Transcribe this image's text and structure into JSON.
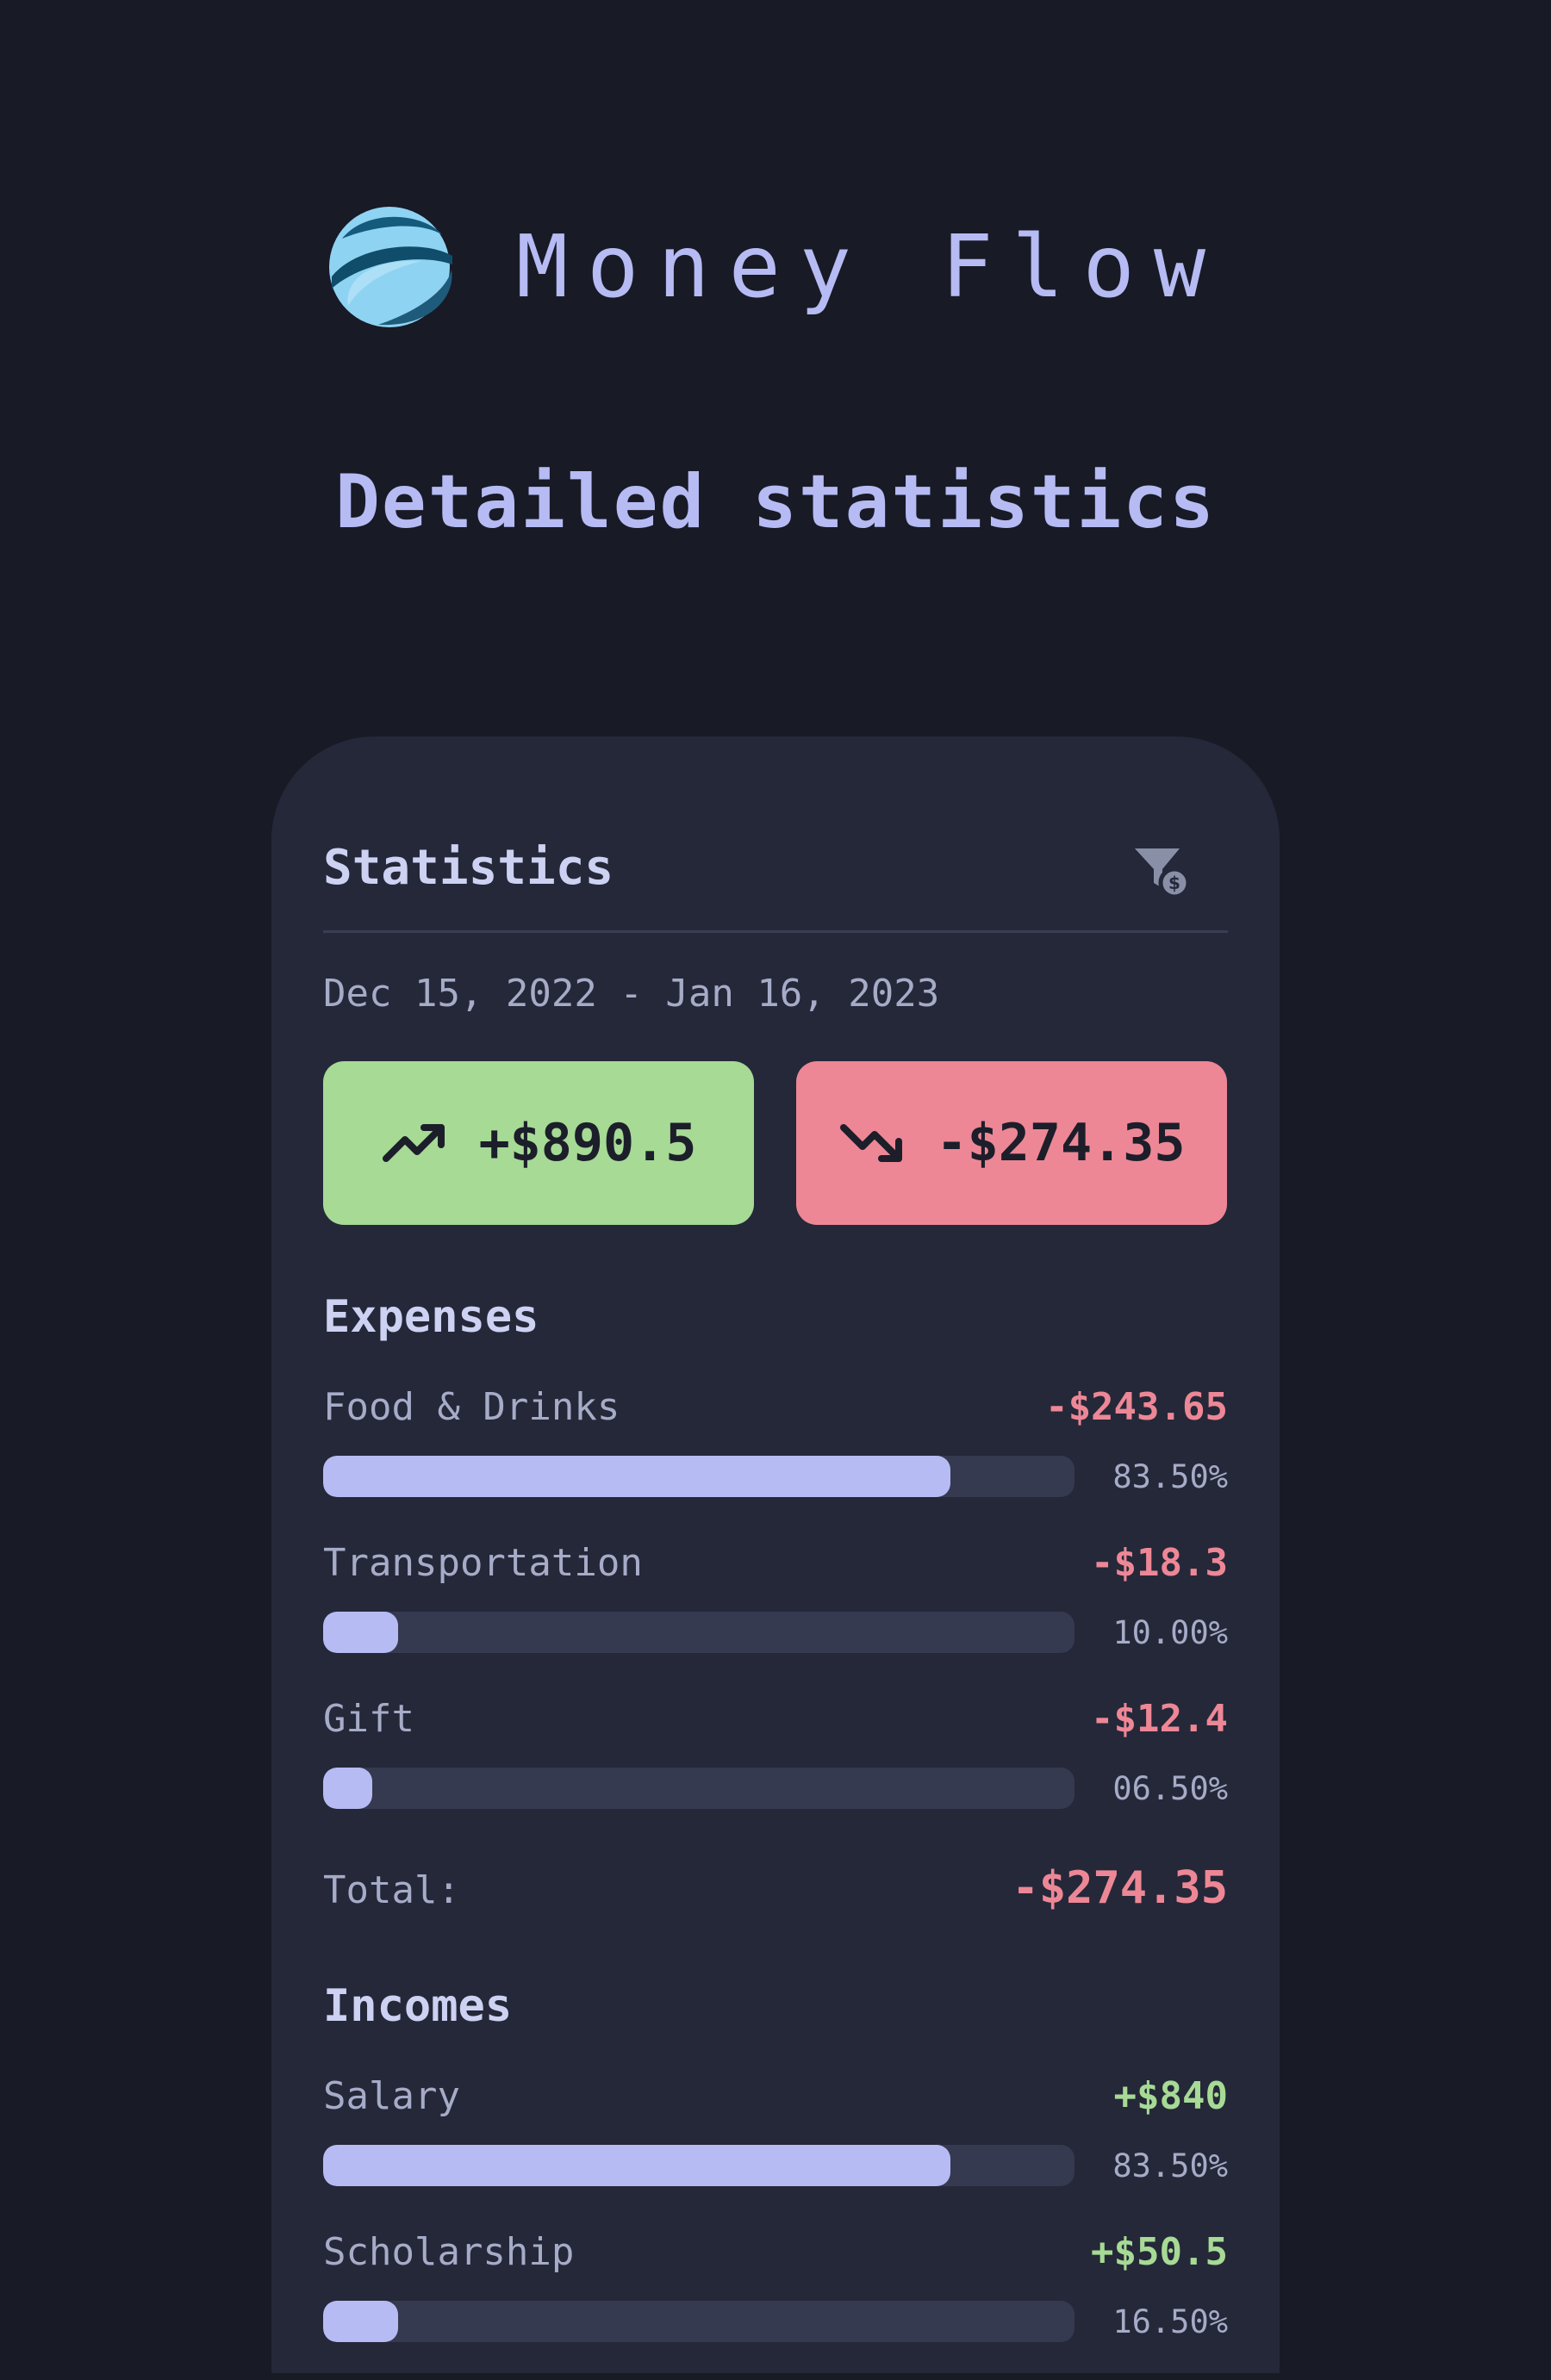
{
  "app": {
    "name": "Money Flow",
    "logo": "globe-swirl-logo"
  },
  "page": {
    "title": "Detailed statistics"
  },
  "statistics": {
    "title": "Statistics",
    "filter_icon": "filter-dollar-icon",
    "date_range": "Dec 15, 2022 - Jan 16, 2023",
    "income_summary": {
      "icon": "trending-up-icon",
      "amount": "+$890.5",
      "color": "#a6da95"
    },
    "expense_summary": {
      "icon": "trending-down-icon",
      "amount": "-$274.35",
      "color": "#ed8796"
    }
  },
  "expenses": {
    "heading": "Expenses",
    "items": [
      {
        "name": "Food & Drinks",
        "amount": "-$243.65",
        "percent": "83.50%",
        "fraction": 0.835
      },
      {
        "name": "Transportation",
        "amount": "-$18.3",
        "percent": "10.00%",
        "fraction": 0.1
      },
      {
        "name": "Gift",
        "amount": "-$12.4",
        "percent": "06.50%",
        "fraction": 0.065
      }
    ],
    "total_label": "Total:",
    "total_amount": "-$274.35"
  },
  "incomes": {
    "heading": "Incomes",
    "items": [
      {
        "name": "Salary",
        "amount": "+$840",
        "percent": "83.50%",
        "fraction": 0.835
      },
      {
        "name": "Scholarship",
        "amount": "+$50.5",
        "percent": "16.50%",
        "fraction": 0.1
      }
    ]
  },
  "colors": {
    "background": "#181a26",
    "card": "#252839",
    "accent": "#b6bbf3",
    "positive": "#a6da95",
    "negative": "#ed8796"
  }
}
